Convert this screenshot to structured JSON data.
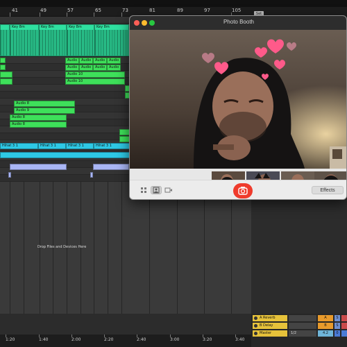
{
  "daw": {
    "ruler_marks": [
      "41",
      "49",
      "57",
      "65",
      "73",
      "81",
      "89",
      "97",
      "105"
    ],
    "set_label": "Set",
    "clips": {
      "key": "Key 8m",
      "audio10": "Audio 10",
      "audio": "Audio",
      "audio8": "Audio 8",
      "audio9": "Audio 9",
      "hihat": "Hihat 3 1"
    },
    "drop_hint": "Drop Files and Devices Here",
    "time_marks": [
      "1:20",
      "1:40",
      "2:00",
      "2:20",
      "2:40",
      "3:00",
      "3:20",
      "3:40"
    ],
    "returns": [
      {
        "letter": "A",
        "name": "A Reverb",
        "btn": "A",
        "s": "S"
      },
      {
        "letter": "B",
        "name": "B Delay",
        "btn": "B",
        "s": "S"
      },
      {
        "letter": "",
        "name": "Master",
        "mid": "1/2",
        "btn": "4.2",
        "s": "0"
      }
    ]
  },
  "photobooth": {
    "title": "Photo Booth",
    "effects_label": "Effects",
    "icons": {
      "grid": "grid-icon",
      "single": "single-photo-icon",
      "video": "video-icon",
      "shutter": "camera-icon"
    }
  }
}
